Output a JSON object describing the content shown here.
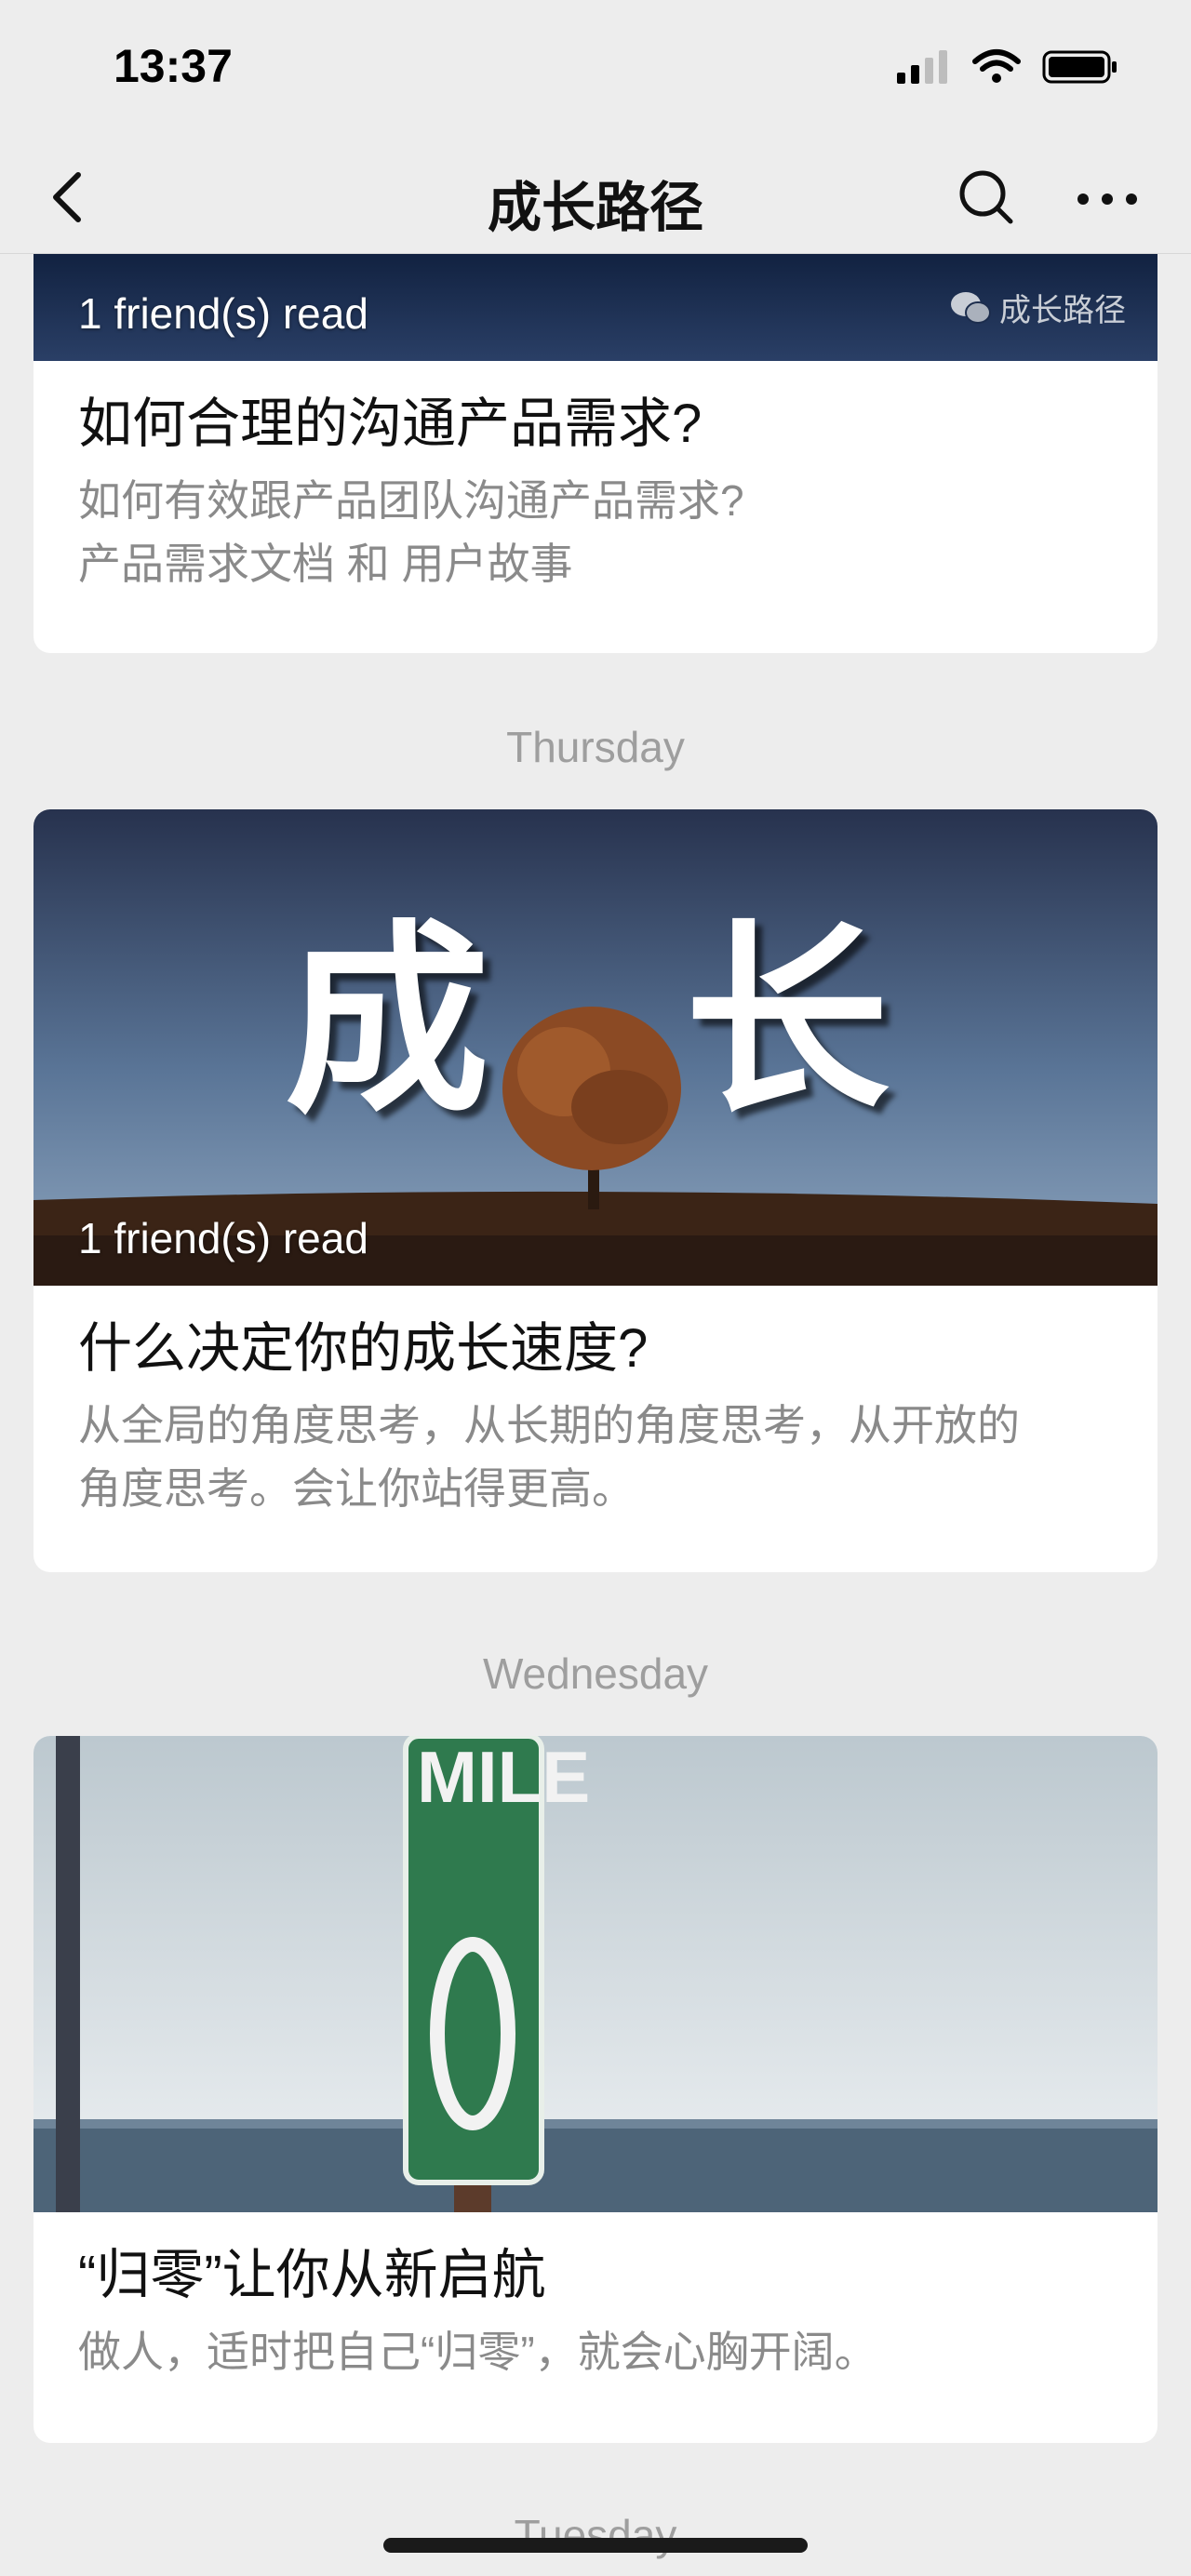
{
  "status_bar": {
    "time": "13:37"
  },
  "nav": {
    "title": "成长路径"
  },
  "articles": [
    {
      "read_label": "1 friend(s) read",
      "watermark": "成长路径",
      "title": "如何合理的沟通产品需求?",
      "desc_line1": "如何有效跟产品团队沟通产品需求?",
      "desc_line2": "产品需求文档 和 用户故事"
    },
    {
      "day": "Thursday",
      "cover_text_left": "成",
      "cover_text_right": "长",
      "read_label": "1 friend(s) read",
      "title": "什么决定你的成长速度?",
      "desc_line1": "从全局的角度思考，从长期的角度思考，从开放的",
      "desc_line2": "角度思考。会让你站得更高。"
    },
    {
      "day": "Wednesday",
      "sign_text": "MILE",
      "sign_number": "0",
      "title": "“归零”让你从新启航",
      "desc_line1": "做人，适时把自己“归零”，就会心胸开阔。"
    }
  ],
  "next_day": "Tuesday",
  "colors": {
    "background": "#ededed",
    "card": "#ffffff",
    "sign_green": "#2f7a4e"
  }
}
